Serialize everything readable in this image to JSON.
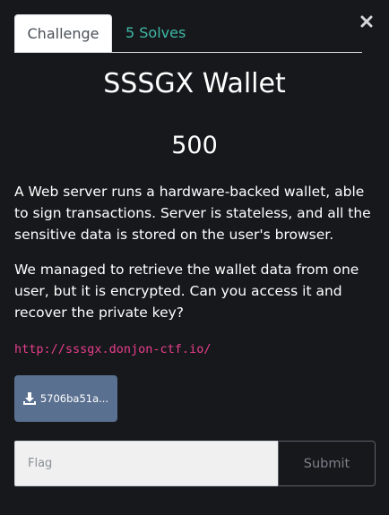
{
  "tabs": [
    {
      "label": "Challenge",
      "active": true
    },
    {
      "label": "5 Solves",
      "active": false
    }
  ],
  "challenge": {
    "title": "SSSGX Wallet",
    "value": "500",
    "description": [
      "A Web server runs a hardware-backed wallet, able to sign transactions. Server is stateless, and all the sensitive data is stored on the user's browser.",
      "We managed to retrieve the wallet data from one user, but it is encrypted. Can you access it and recover the private key?"
    ],
    "url": "http://sssgx.donjon-ctf.io/",
    "file": {
      "label": "5706ba51a...",
      "icon": "download-icon"
    }
  },
  "flag_form": {
    "placeholder": "Flag",
    "value": "",
    "submit_label": "Submit"
  },
  "colors": {
    "background": "#17181c",
    "tab_link": "#3fb9a6",
    "url": "#e83e8c",
    "file_button": "#5a7090"
  }
}
